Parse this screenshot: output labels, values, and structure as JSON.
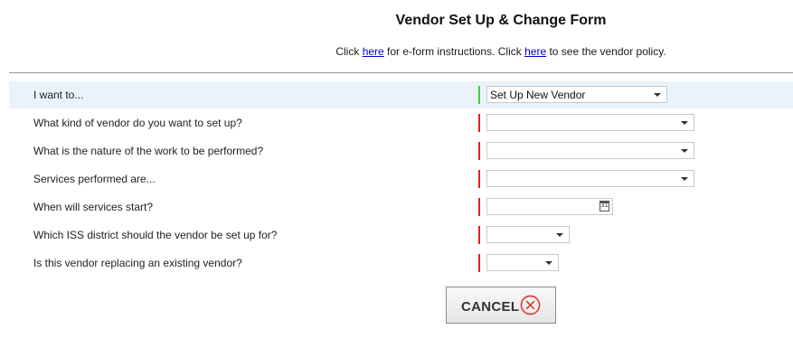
{
  "form": {
    "title": "Vendor Set Up & Change Form",
    "instructions": {
      "part1": "Click ",
      "link1": "here",
      "part2": " for e-form instructions.  Click ",
      "link2": "here",
      "part3": " to see the vendor policy."
    }
  },
  "fields": [
    {
      "label": "I want to...",
      "value": "Set Up New Vendor",
      "type": "select",
      "status": "valid"
    },
    {
      "label": "What kind of vendor do you want to set up?",
      "value": "",
      "type": "select",
      "status": "required"
    },
    {
      "label": "What is the nature of the work to be performed?",
      "value": "",
      "type": "select",
      "status": "required"
    },
    {
      "label": "Services performed are...",
      "value": "",
      "type": "select",
      "status": "required"
    },
    {
      "label": "When will services start?",
      "value": "",
      "type": "date",
      "status": "required"
    },
    {
      "label": "Which ISS district should the vendor be set up for?",
      "value": "",
      "type": "select",
      "status": "required"
    },
    {
      "label": "Is this vendor replacing an existing vendor?",
      "value": "",
      "type": "select",
      "status": "required"
    }
  ],
  "calendar_icon_text": "31",
  "buttons": {
    "cancel_label": "CANCEL"
  },
  "colors": {
    "valid_marker": "#3fcf4a",
    "required_marker": "#e02020",
    "highlight_row": "#eaf3fb",
    "cancel_icon": "#e0302a"
  }
}
